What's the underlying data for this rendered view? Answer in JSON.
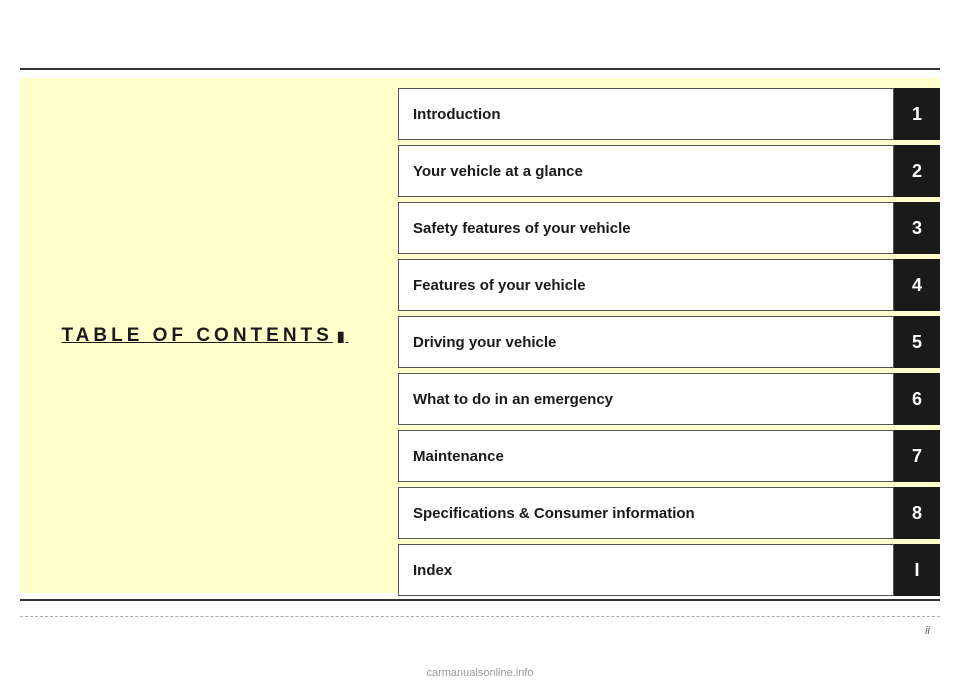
{
  "page": {
    "page_number": "ii"
  },
  "left_panel": {
    "title": "TABLE OF CONTENTS"
  },
  "toc_items": [
    {
      "label": "Introduction",
      "number": "1"
    },
    {
      "label": "Your vehicle at a glance",
      "number": "2"
    },
    {
      "label": "Safety features of your vehicle",
      "number": "3"
    },
    {
      "label": "Features of your vehicle",
      "number": "4"
    },
    {
      "label": "Driving your vehicle",
      "number": "5"
    },
    {
      "label": "What to do in an emergency",
      "number": "6"
    },
    {
      "label": "Maintenance",
      "number": "7"
    },
    {
      "label": "Specifications & Consumer information",
      "number": "8"
    },
    {
      "label": "Index",
      "number": "I"
    }
  ],
  "watermark": {
    "text": "carmanualsonline.info"
  }
}
